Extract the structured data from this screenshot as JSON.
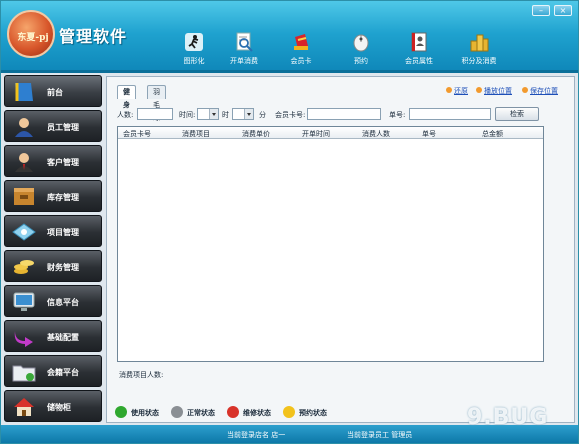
{
  "app": {
    "logo_text": "东夏-pj",
    "title": "管理软件",
    "window_controls": {
      "minimize": "–",
      "close": "×"
    }
  },
  "toolbar": [
    {
      "label": "图形化",
      "icon": "run-figure-icon"
    },
    {
      "label": "开单消费",
      "icon": "magnifier-document-icon"
    },
    {
      "label": "会员卡",
      "icon": "card-icon"
    },
    {
      "label": "预约",
      "icon": "mouse-icon"
    },
    {
      "label": "会员属性",
      "icon": "contact-book-icon"
    },
    {
      "label": "积分及消费",
      "icon": "coin-stack-icon"
    }
  ],
  "sidebar": {
    "items": [
      {
        "label": "前台",
        "icon": "book-icon"
      },
      {
        "label": "员工管理",
        "icon": "employee-icon"
      },
      {
        "label": "客户管理",
        "icon": "customer-icon"
      },
      {
        "label": "库存管理",
        "icon": "inventory-icon"
      },
      {
        "label": "项目管理",
        "icon": "project-icon"
      },
      {
        "label": "财务管理",
        "icon": "coins-icon"
      },
      {
        "label": "信息平台",
        "icon": "monitor-icon"
      },
      {
        "label": "基础配置",
        "icon": "arrow-config-icon"
      },
      {
        "label": "会籍平台",
        "icon": "folder-icon"
      },
      {
        "label": "储物柜",
        "icon": "house-icon"
      }
    ]
  },
  "tabs": [
    {
      "label": "健身",
      "active": true
    },
    {
      "label": "羽毛球",
      "active": false
    }
  ],
  "top_links": [
    {
      "label": "还原"
    },
    {
      "label": "播放位置"
    },
    {
      "label": "保存位置"
    }
  ],
  "filters": {
    "people_label": "人数:",
    "people_value": "",
    "time_label": "时间:",
    "hour_unit": "时",
    "minute_unit": "分",
    "card_label": "会员卡号:",
    "card_value": "",
    "order_label": "单号:",
    "order_value": "",
    "search_button": "检索"
  },
  "grid": {
    "columns": [
      "会员卡号",
      "消费项目",
      "消费单价",
      "开单时间",
      "消费人数",
      "单号",
      "总金额"
    ],
    "rows": []
  },
  "summary": {
    "label": "消费项目人数:"
  },
  "legend": [
    {
      "label": "使用状态",
      "color": "#2fa82f"
    },
    {
      "label": "正常状态",
      "color": "#8a8f94"
    },
    {
      "label": "维修状态",
      "color": "#d8332a"
    },
    {
      "label": "预约状态",
      "color": "#f2c21c"
    }
  ],
  "status": {
    "store": "当前登录店名 店一",
    "user": "当前登录员工 管理员"
  },
  "watermark": "9.BUG"
}
